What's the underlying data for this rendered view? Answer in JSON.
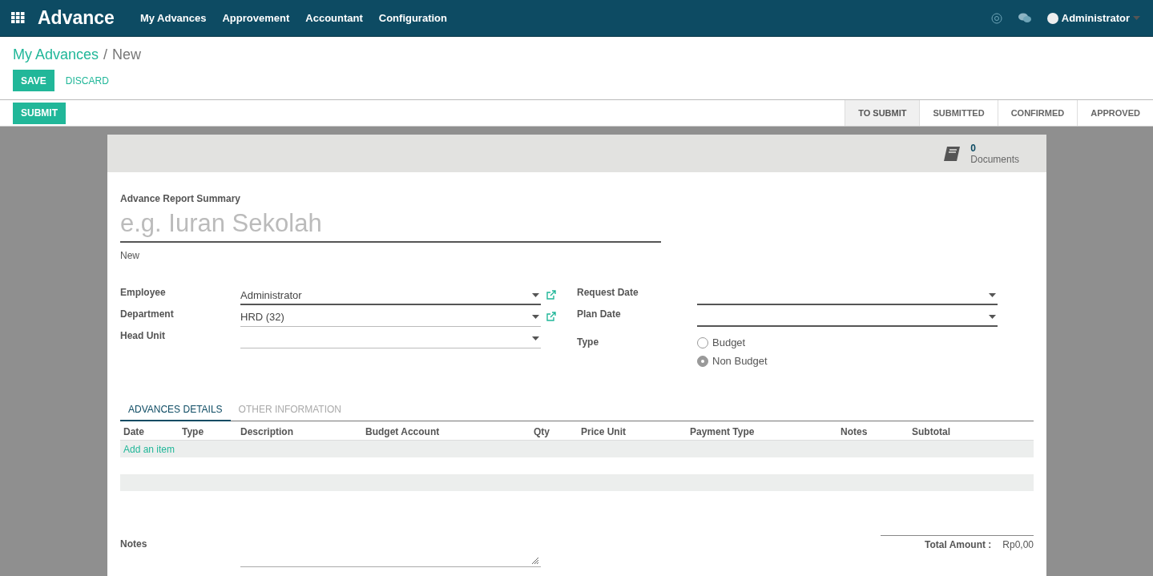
{
  "navbar": {
    "app_title": "Advance",
    "menu": [
      "My Advances",
      "Approvement",
      "Accountant",
      "Configuration"
    ],
    "user": "Administrator"
  },
  "breadcrumb": {
    "parent": "My Advances",
    "separator": "/",
    "current": "New"
  },
  "actions": {
    "save": "SAVE",
    "discard": "DISCARD",
    "submit": "SUBMIT"
  },
  "stages": [
    {
      "label": "TO SUBMIT",
      "selected": true
    },
    {
      "label": "SUBMITTED",
      "selected": false
    },
    {
      "label": "CONFIRMED",
      "selected": false
    },
    {
      "label": "APPROVED",
      "selected": false
    }
  ],
  "documents": {
    "count": "0",
    "label": "Documents"
  },
  "form": {
    "summary_label": "Advance Report Summary",
    "summary_placeholder": "e.g. Iuran Sekolah",
    "state": "New",
    "left_fields": [
      {
        "label": "Employee",
        "value": "Administrator",
        "required": true,
        "external_link": true
      },
      {
        "label": "Department",
        "value": "HRD (32)",
        "required": false,
        "external_link": true
      },
      {
        "label": "Head Unit",
        "required": false,
        "external_link": false
      }
    ],
    "right_fields": [
      {
        "label": "Request Date",
        "kind": "date",
        "required": true
      },
      {
        "label": "Plan Date",
        "kind": "date",
        "required": true
      },
      {
        "label": "Type",
        "kind": "radio",
        "options": [
          {
            "label": "Budget",
            "selected": false
          },
          {
            "label": "Non Budget",
            "selected": true
          }
        ]
      }
    ]
  },
  "tabs": [
    {
      "label": "ADVANCES DETAILS",
      "selected": true
    },
    {
      "label": "OTHER INFORMATION",
      "selected": false
    }
  ],
  "table": {
    "columns": [
      "Date",
      "Type",
      "Description",
      "Budget Account",
      "Qty",
      "Price Unit",
      "Payment Type",
      "Notes",
      "Subtotal"
    ],
    "add_item": "Add an item"
  },
  "footer": {
    "notes_label": "Notes",
    "total_label": "Total Amount :",
    "total": "Rp0,00"
  }
}
